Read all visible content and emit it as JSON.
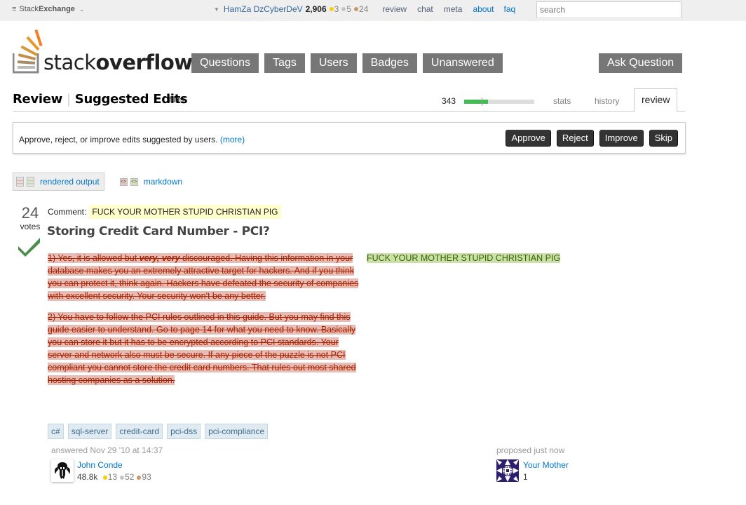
{
  "topbar": {
    "brand_prefix": "Stack",
    "brand_bold": "Exchange",
    "user_name": "HamZa DzCyberDeV",
    "reputation": "2,906",
    "badges": {
      "gold": "3",
      "silver": "5",
      "bronze": "24"
    },
    "links": [
      "review",
      "chat",
      "meta",
      "about",
      "faq"
    ],
    "search_placeholder": "search"
  },
  "header": {
    "logo_prefix": "stack",
    "logo_bold": "overflow",
    "nav": [
      "Questions",
      "Tags",
      "Users",
      "Badges",
      "Unanswered"
    ],
    "ask_button": "Ask Question"
  },
  "subheader": {
    "section": "Review",
    "queue": "Suggested Edits",
    "filter": "filter",
    "review_count": "343",
    "progress_fraction": 0.34,
    "progress_marker_fraction": 0.25,
    "tabs": [
      "stats",
      "history",
      "review"
    ],
    "active_tab": "review"
  },
  "info": {
    "message": "Approve, reject, or improve edits suggested by users.",
    "more_link": "(more)",
    "actions": [
      "Approve",
      "Reject",
      "Improve",
      "Skip"
    ]
  },
  "view_modes": {
    "rendered": "rendered output",
    "markdown": "markdown",
    "active": "rendered"
  },
  "post": {
    "votes": "24",
    "votes_label": "votes",
    "accepted": true,
    "comment_label": "Comment:",
    "comment_value": "FUCK YOUR MOTHER STUPID CHRISTIAN PIG",
    "title": "Storing Credit Card Number - PCI?",
    "removed_p1_before": "1) Yes, it is allowed but ",
    "removed_p1_emph": "very, very",
    "removed_p1_after": " discouraged. Having this information in your database makes you an extremely attractive target for hackers. And if you think you can protect it, think again. Hackers have defeated the security of companies with excellent security. Your security won't be any better.",
    "removed_p2": "2) You have to follow the PCI rules outlined in this guide. But you may find this guide easier to understand. Go to page 14 for what you need to know. Basically you can store it but it has to be encrypted according to PCI standards. Your server and network also must be secure. If any piece of the puzzle is not PCI compliant you cannot store the credit card numbers. That rules out most shared hosting companies as a solution.",
    "inserted_text": "FUCK YOUR MOTHER STUPID CHRISTIAN PIG",
    "tags": [
      "c#",
      "sql-server",
      "credit-card",
      "pci-dss",
      "pci-compliance"
    ]
  },
  "answerer": {
    "action": "answered Nov 29 '10 at 14:37",
    "name": "John Conde",
    "reputation": "48.8k",
    "badges": {
      "gold": "13",
      "silver": "52",
      "bronze": "93"
    }
  },
  "proposer": {
    "action": "proposed just now",
    "name": "Your Mother",
    "reputation": "1"
  },
  "colors": {
    "removed_bg": "#e6bcb5",
    "removed_text": "#aa2200",
    "inserted_bg": "#cde0a9",
    "inserted_text": "#336600",
    "comment_bg": "#ffffcc",
    "link": "#0077cc",
    "nav_button": "#777777",
    "progress_green": "#44bb55",
    "accepted_check": "#4d8c4d"
  }
}
